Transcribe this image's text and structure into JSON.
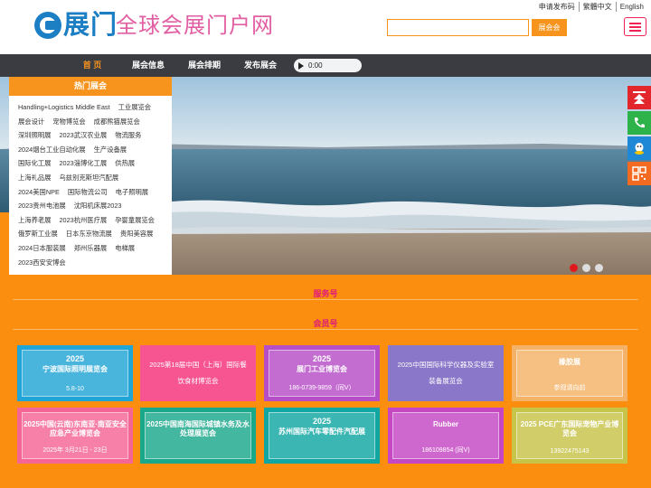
{
  "header": {
    "logo_text": "展门",
    "slogan": "全球会展门户网",
    "top_links": [
      "申请发布码",
      "繁體中文",
      "English"
    ],
    "search": {
      "placeholder": "",
      "button": "展会会"
    }
  },
  "nav": {
    "items": [
      "首 页",
      "展会信息",
      "展会排期",
      "发布展会"
    ]
  },
  "audio": {
    "time": "0:00"
  },
  "sidebar": {
    "title": "热门展会",
    "links": [
      "Handling+Logistics Middle East",
      "工业展览会",
      "展会设计",
      "宠物博览会",
      "成都熊猫展览会",
      "深圳照明展",
      "2023武汉农业展",
      "物流服务",
      "2024烟台工业自动化展",
      "生产设备展",
      "国际化工展",
      "2023淄博化工展",
      "供热展",
      "上海礼品展",
      "乌兹别克斯坦汽配展",
      "2024美国NPE",
      "国际物流公司",
      "电子照明展",
      "2023贵州电池展",
      "沈阳机床展2023",
      "上海养老展",
      "2023杭州医疗展",
      "孕婴童展览会",
      "俄罗斯工业展",
      "日本东京物流展",
      "贵阳美容展",
      "2024日本服装展",
      "郑州乐器展",
      "电梯展",
      "2023西安安博会"
    ]
  },
  "sections": {
    "service": "服务号",
    "member": "会员号"
  },
  "cards": [
    {
      "name": "card-ningbo-lighting",
      "title": "宁波国际照明展览会",
      "year": "2025",
      "sub": "5.8-10",
      "bg": "#21a5d6"
    },
    {
      "name": "card-shanghai-catering",
      "text": "2025第18届中国（上海）国际餐饮食材博览会",
      "bg": "#f75592"
    },
    {
      "name": "card-hangzhou-industry",
      "title": "展门工业博览会",
      "year": "2025",
      "phone": "186-0739-9859（同V）",
      "bg": "#b64ec7"
    },
    {
      "name": "card-instrument-lab",
      "text": "2025中国国际科学仪器及实验室装备展览会",
      "bg": "#8b77c9"
    },
    {
      "name": "card-rubber",
      "title": "橡胶展",
      "sub": "参观请向前",
      "bg": "#f3b267"
    },
    {
      "name": "card-yunnan-safety",
      "title": "2025中国(云南)东南亚·南亚安全应急产业博览会",
      "sub": "2025年 3月21日 - 23日",
      "bg": "#f56595"
    },
    {
      "name": "card-water-expo",
      "title": "2025中国南海国际城镇水务及水处理展览会",
      "bg": "#1aa88a"
    },
    {
      "name": "card-suzhou-auto",
      "title": "苏州国际汽车零配件汽配展",
      "year": "2025",
      "bg": "#10a7a3"
    },
    {
      "name": "card-rubber-expo",
      "title": "Rubber",
      "phone": "186109854 (同V)",
      "bg": "#c547c4"
    },
    {
      "name": "card-pet-industry",
      "title": "2025 PCE广东国际宠物产业博览会",
      "phone": "13922475143",
      "bg": "#c7c44a"
    }
  ],
  "colors": {
    "accent": "#f7941d",
    "nav_bg": "#3a3c42",
    "page_bg": "#fb8d0f",
    "brand_blue": "#1c7fc4",
    "brand_pink": "#e25ea2"
  },
  "floating_icons": [
    "back-to-top-icon",
    "phone-icon",
    "qq-icon",
    "qr-code-icon"
  ]
}
